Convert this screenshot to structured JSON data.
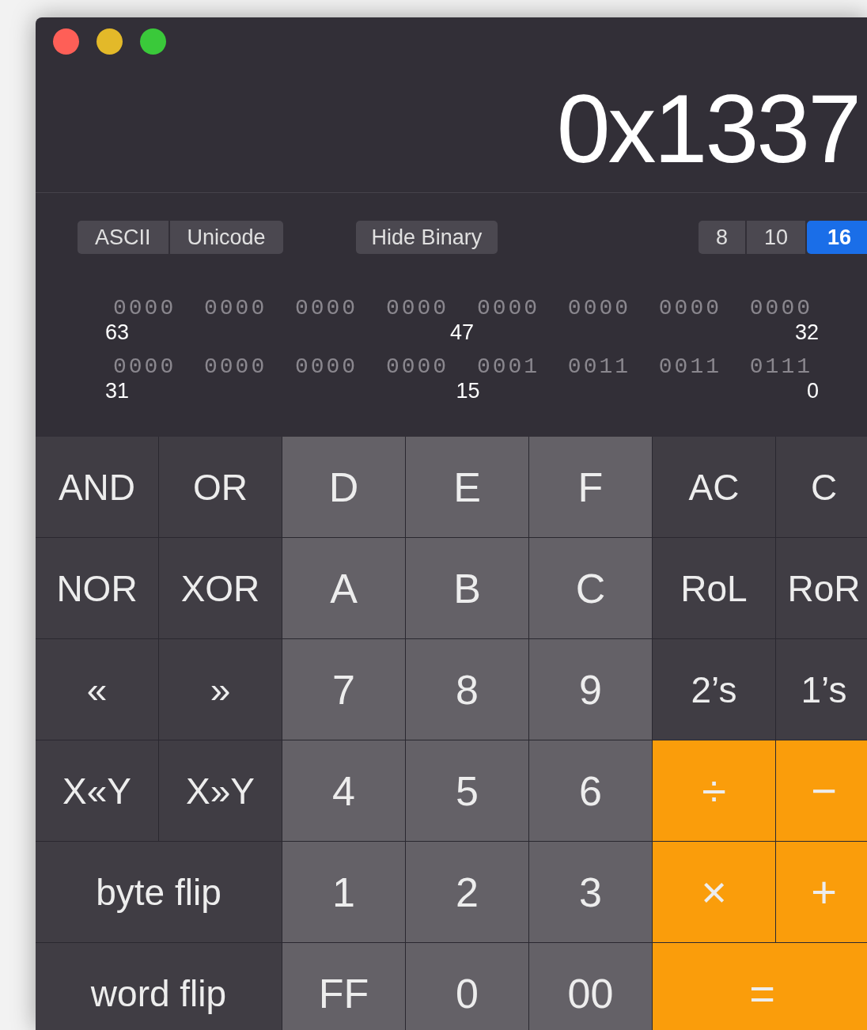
{
  "display": {
    "value": "0x1337"
  },
  "modes": [
    {
      "label": "ASCII",
      "selected": false
    },
    {
      "label": "Unicode",
      "selected": false
    }
  ],
  "binary_toggle": {
    "label": "Hide Binary"
  },
  "bases": [
    {
      "label": "8",
      "selected": false
    },
    {
      "label": "10",
      "selected": false
    },
    {
      "label": "16",
      "selected": true
    }
  ],
  "binary_rows": [
    {
      "groups": [
        "0000",
        "0000",
        "0000",
        "0000",
        "0000",
        "0000",
        "0000",
        "0000"
      ],
      "bit_labels": [
        "63",
        "47",
        "32"
      ]
    },
    {
      "groups": [
        "0000",
        "0000",
        "0000",
        "0000",
        "0001",
        "0011",
        "0011",
        "0111"
      ],
      "bit_labels": [
        "31",
        "15",
        "0"
      ]
    }
  ],
  "keys": [
    [
      {
        "label": "AND",
        "kind": "func"
      },
      {
        "label": "OR",
        "kind": "func"
      },
      {
        "label": "D",
        "kind": "digit"
      },
      {
        "label": "E",
        "kind": "digit"
      },
      {
        "label": "F",
        "kind": "digit"
      },
      {
        "label": "AC",
        "kind": "func"
      },
      {
        "label": "C",
        "kind": "func"
      }
    ],
    [
      {
        "label": "NOR",
        "kind": "func"
      },
      {
        "label": "XOR",
        "kind": "func"
      },
      {
        "label": "A",
        "kind": "digit"
      },
      {
        "label": "B",
        "kind": "digit"
      },
      {
        "label": "C",
        "kind": "digit"
      },
      {
        "label": "RoL",
        "kind": "func"
      },
      {
        "label": "RoR",
        "kind": "func"
      }
    ],
    [
      {
        "label": "«",
        "kind": "func"
      },
      {
        "label": "»",
        "kind": "func"
      },
      {
        "label": "7",
        "kind": "digit"
      },
      {
        "label": "8",
        "kind": "digit"
      },
      {
        "label": "9",
        "kind": "digit"
      },
      {
        "label": "2’s",
        "kind": "func"
      },
      {
        "label": "1’s",
        "kind": "func"
      }
    ],
    [
      {
        "label": "X«Y",
        "kind": "func"
      },
      {
        "label": "X»Y",
        "kind": "func"
      },
      {
        "label": "4",
        "kind": "digit"
      },
      {
        "label": "5",
        "kind": "digit"
      },
      {
        "label": "6",
        "kind": "digit"
      },
      {
        "label": "÷",
        "kind": "op"
      },
      {
        "label": "−",
        "kind": "op"
      }
    ],
    [
      {
        "label": "byte flip",
        "kind": "func",
        "wide": true
      },
      {
        "label": "1",
        "kind": "digit"
      },
      {
        "label": "2",
        "kind": "digit"
      },
      {
        "label": "3",
        "kind": "digit"
      },
      {
        "label": "×",
        "kind": "op"
      },
      {
        "label": "+",
        "kind": "op"
      }
    ],
    [
      {
        "label": "word flip",
        "kind": "func",
        "wide": true
      },
      {
        "label": "FF",
        "kind": "digit"
      },
      {
        "label": "0",
        "kind": "digit"
      },
      {
        "label": "00",
        "kind": "digit"
      },
      {
        "label": "=",
        "kind": "op",
        "wide": true
      }
    ]
  ]
}
